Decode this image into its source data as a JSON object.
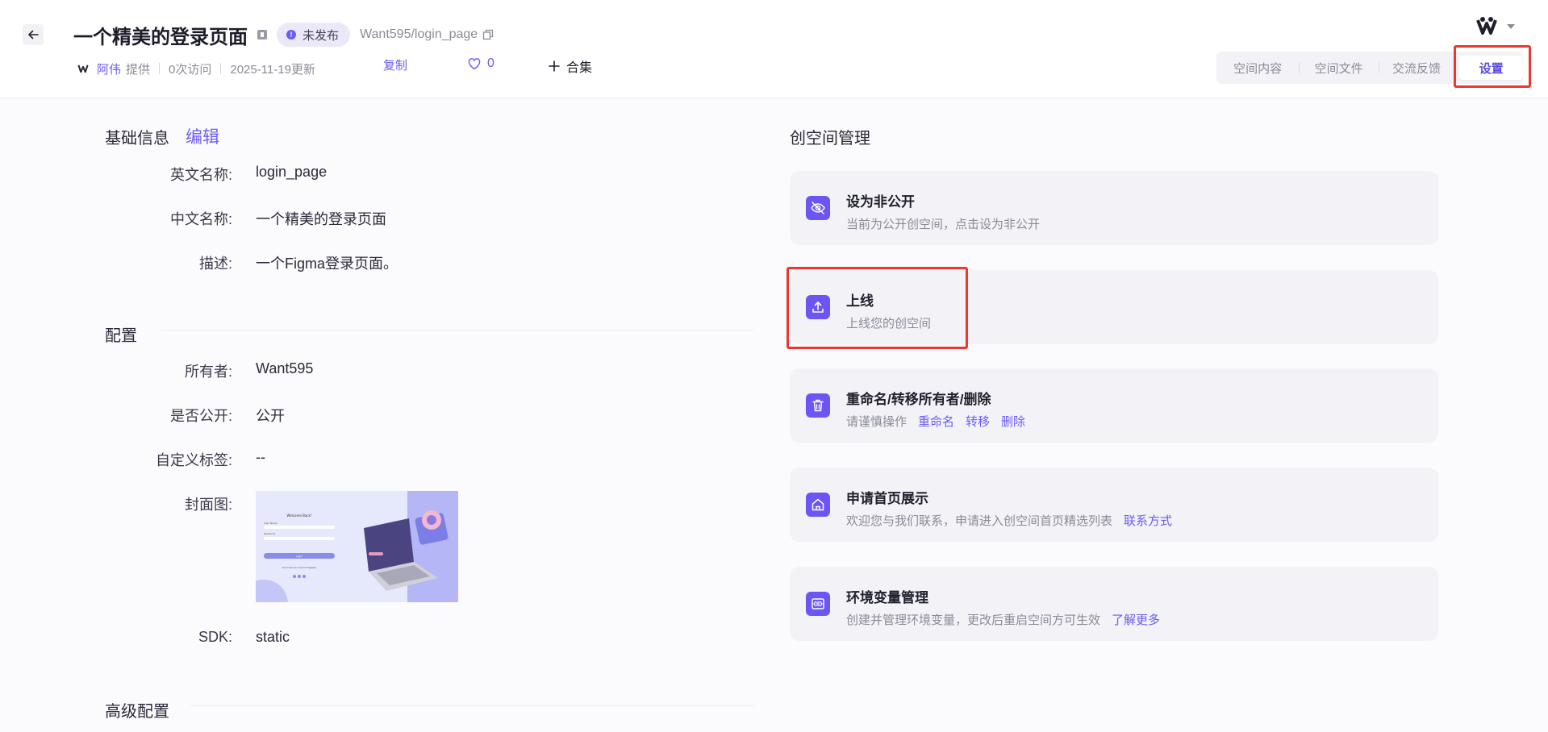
{
  "header": {
    "title": "一个精美的登录页面",
    "status": "未发布",
    "repo_path": "Want595/login_page",
    "author": "阿伟",
    "provided": "提供",
    "visits": "0次访问",
    "updated": "2025-11-19更新",
    "copy_label": "复制",
    "like_count": "0",
    "collect_label": "合集"
  },
  "tabs": [
    {
      "label": "空间内容",
      "active": false
    },
    {
      "label": "空间文件",
      "active": false
    },
    {
      "label": "交流反馈",
      "active": false
    },
    {
      "label": "设置",
      "active": true
    }
  ],
  "basic_info": {
    "heading": "基础信息",
    "edit_label": "编辑",
    "fields": [
      {
        "label": "英文名称:",
        "value": "login_page"
      },
      {
        "label": "中文名称:",
        "value": "一个精美的登录页面"
      },
      {
        "label": "描述:",
        "value": "一个Figma登录页面。"
      }
    ]
  },
  "config": {
    "heading": "配置",
    "fields": [
      {
        "label": "所有者:",
        "value": "Want595"
      },
      {
        "label": "是否公开:",
        "value": "公开"
      },
      {
        "label": "自定义标签:",
        "value": "--"
      },
      {
        "label": "封面图:",
        "value": ""
      },
      {
        "label": "SDK:",
        "value": "static"
      }
    ],
    "cover_text": {
      "welcome": "Welcome Back!",
      "username": "User Name",
      "password": "Password",
      "login": "Login",
      "footer": "Don't have an account? Register"
    }
  },
  "advanced": {
    "heading": "高级配置"
  },
  "management": {
    "heading": "创空间管理",
    "cards": [
      {
        "title": "设为非公开",
        "desc": "当前为公开创空间，点击设为非公开",
        "icon": "eye-off-icon"
      },
      {
        "title": "上线",
        "desc": "上线您的创空间",
        "icon": "upload-icon"
      },
      {
        "title": "重命名/转移所有者/删除",
        "desc": "请谨慎操作",
        "links": [
          "重命名",
          "转移",
          "删除"
        ],
        "icon": "trash-icon"
      },
      {
        "title": "申请首页展示",
        "desc": "欢迎您与我们联系，申请进入创空间首页精选列表",
        "links": [
          "联系方式"
        ],
        "icon": "home-icon"
      },
      {
        "title": "环境变量管理",
        "desc": "创建并管理环境变量，更改后重启空间方可生效",
        "links": [
          "了解更多"
        ],
        "icon": "variable-icon"
      }
    ]
  },
  "colors": {
    "accent": "#6b5cf6",
    "highlight": "#ee3530",
    "card_bg": "#f2f2f7"
  }
}
